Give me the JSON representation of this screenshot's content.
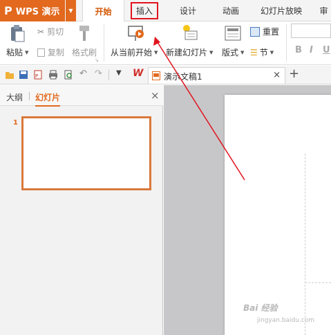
{
  "app": {
    "logo": "P",
    "name": "WPS 演示",
    "accent_color": "#e2691d"
  },
  "menu_tabs": [
    {
      "label": "开始",
      "state": "active"
    },
    {
      "label": "插入",
      "state": "highlighted"
    },
    {
      "label": "设计",
      "state": "normal"
    },
    {
      "label": "动画",
      "state": "normal"
    },
    {
      "label": "幻灯片放映",
      "state": "normal"
    },
    {
      "label": "审",
      "state": "normal"
    }
  ],
  "ribbon": {
    "paste": "粘贴",
    "cut": "剪切",
    "copy": "复制",
    "format_painter": "格式刷",
    "from_current": "从当前开始",
    "new_slide": "新建幻灯片",
    "layout": "版式",
    "reset": "重置",
    "section": "节",
    "bold": "B",
    "italic": "I",
    "underline": "U"
  },
  "doc_tab": {
    "title": "演示文稿1",
    "close": "×",
    "add": "+"
  },
  "left_pane": {
    "tab_outline": "大纲",
    "tab_slides": "幻灯片",
    "close": "×",
    "slide_number": "1"
  },
  "watermark": {
    "text": "Bai 经验",
    "sub": "jingyan.baidu.com"
  }
}
